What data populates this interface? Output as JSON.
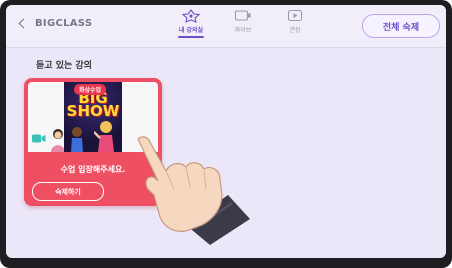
{
  "header": {
    "back_label": "BIGCLASS",
    "tabs": [
      {
        "label": "내 강의실",
        "icon": "classroom-icon",
        "active": true
      },
      {
        "label": "파이브",
        "icon": "live-screen-icon",
        "active": false
      },
      {
        "label": "연장",
        "icon": "video-play-icon",
        "active": false
      }
    ],
    "cancel_all_label": "전체 숙제"
  },
  "section": {
    "title": "듣고 있는 강의"
  },
  "course_card": {
    "badge": "화상수업",
    "poster_title_line1": "BIG",
    "poster_title_line2": "SHOW",
    "status_text": "수업 입장해주세요.",
    "button_label": "숙제하기",
    "accent_color": "#ef4f63"
  },
  "colors": {
    "brand": "#6b4fc8",
    "background": "#ece7f8"
  }
}
